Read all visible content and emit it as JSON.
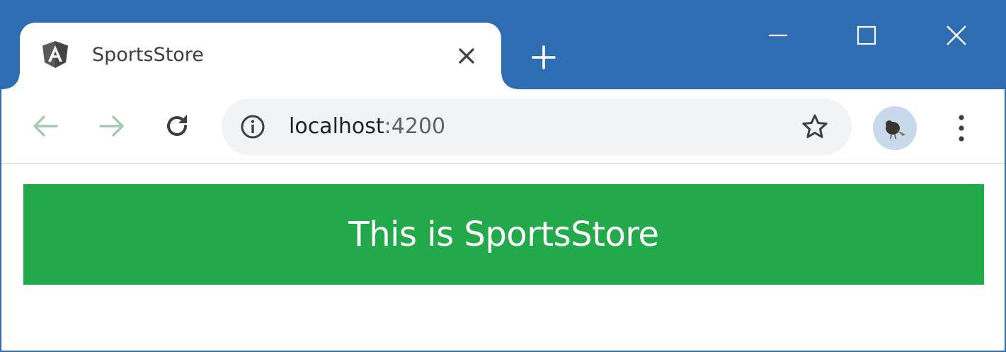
{
  "tab": {
    "title": "SportsStore",
    "favicon_icon": "angular-logo-icon"
  },
  "toolbar": {
    "back_icon": "arrow-left-icon",
    "forward_icon": "arrow-right-icon",
    "reload_icon": "reload-icon"
  },
  "address_bar": {
    "host": "localhost",
    "port": ":4200",
    "info_icon": "info-icon",
    "bookmark_icon": "star-icon"
  },
  "window_controls": {
    "minimize_icon": "minimize-icon",
    "maximize_icon": "maximize-icon",
    "close_icon": "close-icon"
  },
  "page": {
    "banner_text": "This is SportsStore"
  },
  "colors": {
    "titlebar": "#2f6db3",
    "banner": "#22aa4a",
    "banner_text": "#ffffff"
  }
}
